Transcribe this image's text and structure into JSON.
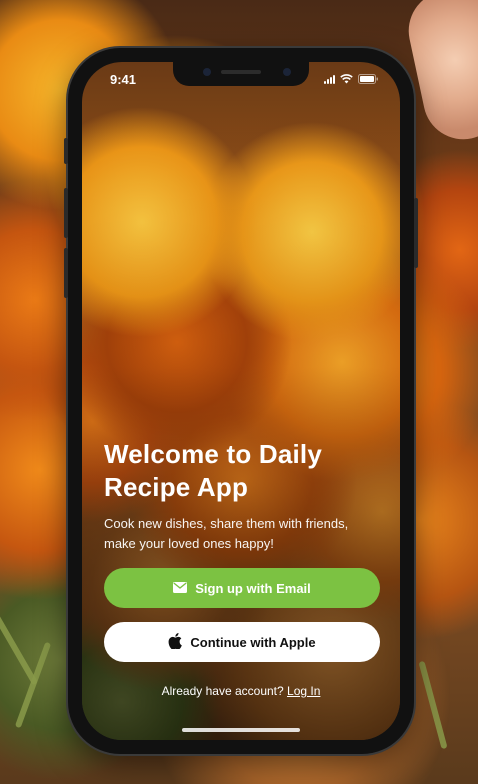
{
  "status_bar": {
    "time": "9:41"
  },
  "welcome": {
    "title": "Welcome to Daily Recipe App",
    "subtitle": "Cook new dishes, share them with friends, make your loved ones happy!"
  },
  "buttons": {
    "email_label": "Sign up with Email",
    "apple_label": "Continue with Apple"
  },
  "login": {
    "prompt": "Already have account?",
    "link_label": "Log In"
  },
  "colors": {
    "accent_green": "#7cc242",
    "button_white": "#ffffff"
  },
  "icons": {
    "email": "envelope-icon",
    "apple": "apple-icon",
    "signal": "signal-icon",
    "wifi": "wifi-icon",
    "battery": "battery-icon"
  }
}
